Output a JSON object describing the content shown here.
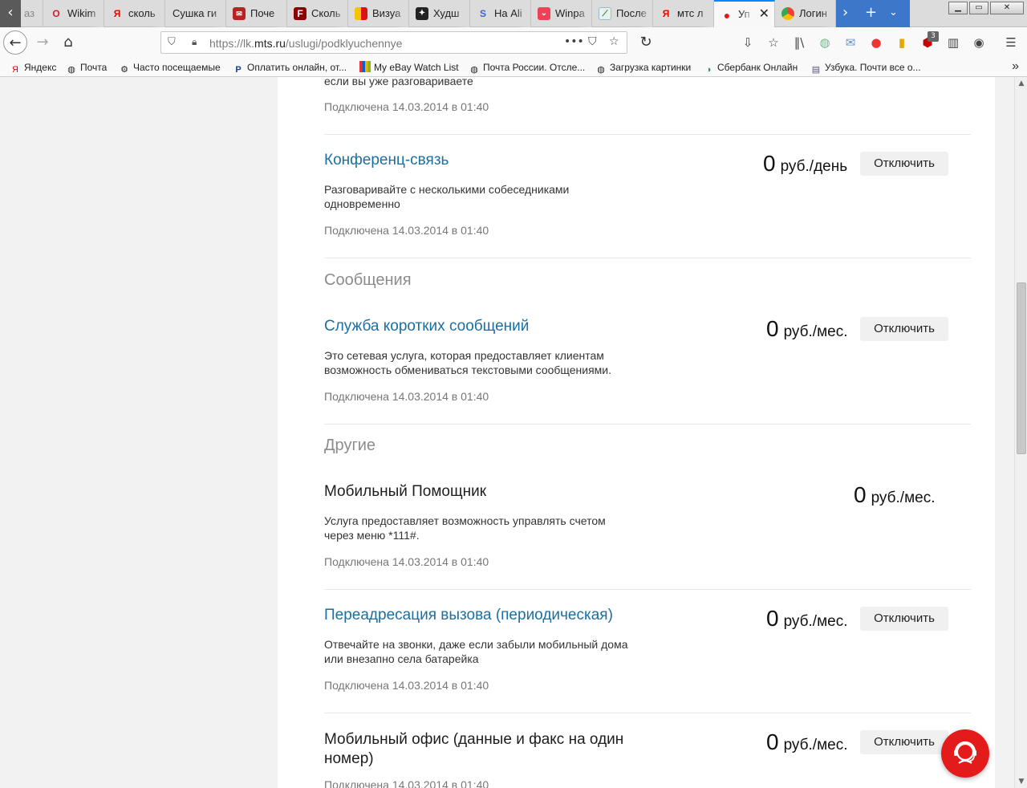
{
  "browser": {
    "tabs": [
      {
        "label": "аз",
        "icon": "globe-icon"
      },
      {
        "label": "Wikim",
        "icon": "opera-icon"
      },
      {
        "label": "сколь",
        "icon": "yandex-icon"
      },
      {
        "label": "Сушка ги",
        "icon": ""
      },
      {
        "label": "Поче",
        "icon": "mail-icon"
      },
      {
        "label": "Сколь",
        "icon": "f-icon"
      },
      {
        "label": "Визуа",
        "icon": "flag-icon"
      },
      {
        "label": "Худш",
        "icon": "star-icon"
      },
      {
        "label": "На Ali",
        "icon": "s-icon"
      },
      {
        "label": "Winpa",
        "icon": "pocket-icon"
      },
      {
        "label": "После",
        "icon": "chart-icon"
      },
      {
        "label": "мтс л",
        "icon": "yandex-icon"
      },
      {
        "label": "Уп",
        "icon": "mts-icon",
        "active": true
      },
      {
        "label": "Логин",
        "icon": "chrome-icon"
      }
    ],
    "url_prefix": "https://lk.",
    "url_domain": "mts.ru",
    "url_path": "/uslugi/podklyuchennye",
    "notification_count": "3",
    "bookmarks": [
      {
        "label": "Яндекс",
        "icon": "yandex-icon"
      },
      {
        "label": "Почта",
        "icon": "globe-icon"
      },
      {
        "label": "Часто посещаемые",
        "icon": "gear-icon"
      },
      {
        "label": "Оплатить онлайн, от...",
        "icon": "paypal-icon"
      },
      {
        "label": "My eBay Watch List",
        "icon": "ebay-icon"
      },
      {
        "label": "Почта России. Отсле...",
        "icon": "globe-icon"
      },
      {
        "label": "Загрузка картинки",
        "icon": "globe-icon"
      },
      {
        "label": "Сбербанк Онлайн",
        "icon": "sberbank-icon"
      },
      {
        "label": "Узбука. Почти все о...",
        "icon": "page-icon"
      }
    ]
  },
  "page": {
    "top_fragment": {
      "desc_tail": "если вы уже разговариваете",
      "date": "Подключена 14.03.2014 в 01:40"
    },
    "conference": {
      "title": "Конференц-связь",
      "desc": "Разговаривайте с несколькими собеседниками одновременно",
      "date": "Подключена 14.03.2014 в 01:40",
      "price": "0",
      "unit": "руб./день",
      "button": "Отключить"
    },
    "section_messages": "Сообщения",
    "sms": {
      "title": "Служба коротких сообщений",
      "desc": "Это сетевая услуга, которая предоставляет клиентам возможность обмениваться текстовыми сообщениями.",
      "date": "Подключена 14.03.2014 в 01:40",
      "price": "0",
      "unit": "руб./мес.",
      "button": "Отключить"
    },
    "section_other": "Другие",
    "assistant": {
      "title": "Мобильный Помощник",
      "desc": "Услуга предоставляет возможность управлять счетом через меню *111#.",
      "date": "Подключена 14.03.2014 в 01:40",
      "price": "0",
      "unit": "руб./мес."
    },
    "forwarding": {
      "title": "Переадресация вызова (периодическая)",
      "desc": "Отвечайте на звонки, даже если забыли мобильный дома или внезапно села батарейка",
      "date": "Подключена 14.03.2014 в 01:40",
      "price": "0",
      "unit": "руб./мес.",
      "button": "Отключить"
    },
    "office": {
      "title_line1": "Мобильный офис (данные и факс на один",
      "title_line2": "номер)",
      "date": "Подключена 14.03.2014 в 01:40",
      "price": "0",
      "unit": "руб./мес.",
      "button": "Отключить"
    }
  },
  "colors": {
    "link": "#1b6fa1",
    "brand_red": "#e41b1b",
    "accent_blue": "#0a84ff"
  }
}
